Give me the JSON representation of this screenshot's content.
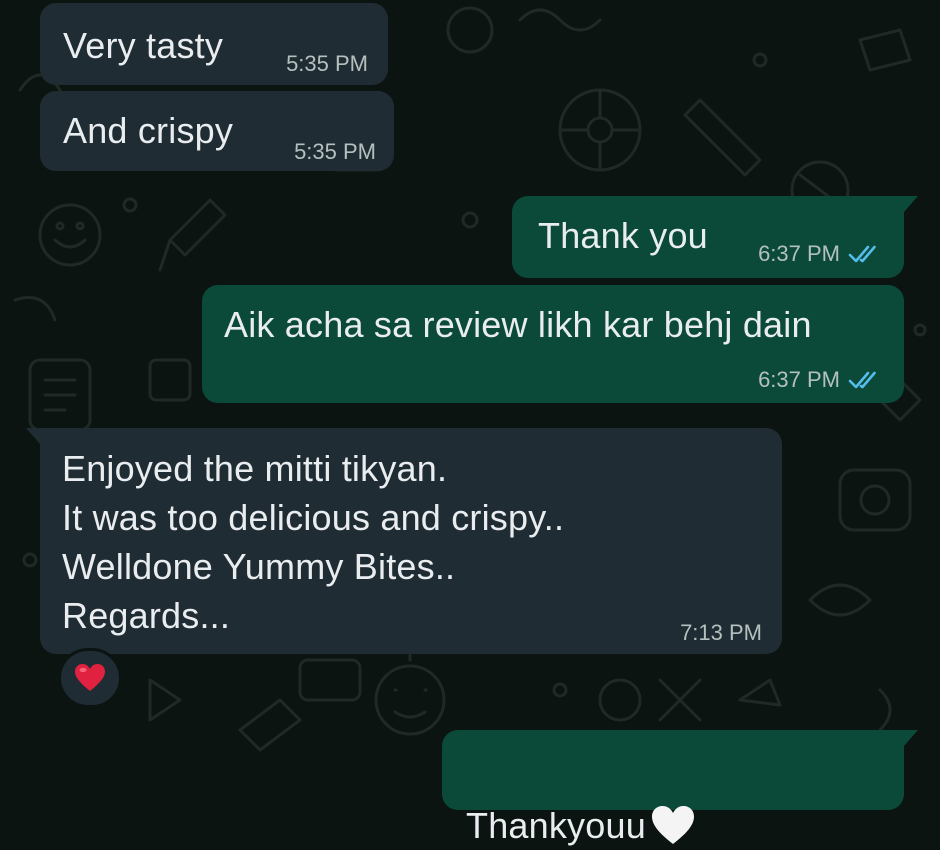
{
  "chat": {
    "messages": [
      {
        "direction": "incoming",
        "text": "Very tasty",
        "time": "5:35 PM"
      },
      {
        "direction": "incoming",
        "text": "And crispy",
        "time": "5:35 PM"
      },
      {
        "direction": "outgoing",
        "text": "Thank you",
        "time": "6:37 PM",
        "status": "read"
      },
      {
        "direction": "outgoing",
        "text": "Aik acha sa review likh kar behj dain",
        "time": "6:37 PM",
        "status": "read"
      },
      {
        "direction": "incoming",
        "text": "Enjoyed the mitti tikyan.\nIt was too delicious and  crispy..\nWelldone Yummy Bites..\nRegards...",
        "time": "7:13 PM",
        "reaction": "red-heart"
      },
      {
        "direction": "outgoing",
        "text": "Thankyouu",
        "trailing_emoji": "white-heart"
      }
    ]
  },
  "colors": {
    "background": "#0b1411",
    "incoming_bubble": "#202c33",
    "outgoing_bubble": "#0b4a38",
    "message_text": "#e9edef",
    "timestamp_text": "#b4c0bd",
    "read_tick": "#53bdeb",
    "reaction_heart": "#e0213f"
  },
  "icons": {
    "read_receipt": "double-check-icon",
    "reaction": "red-heart-emoji",
    "inline_emoji": "white-heart-emoji"
  }
}
